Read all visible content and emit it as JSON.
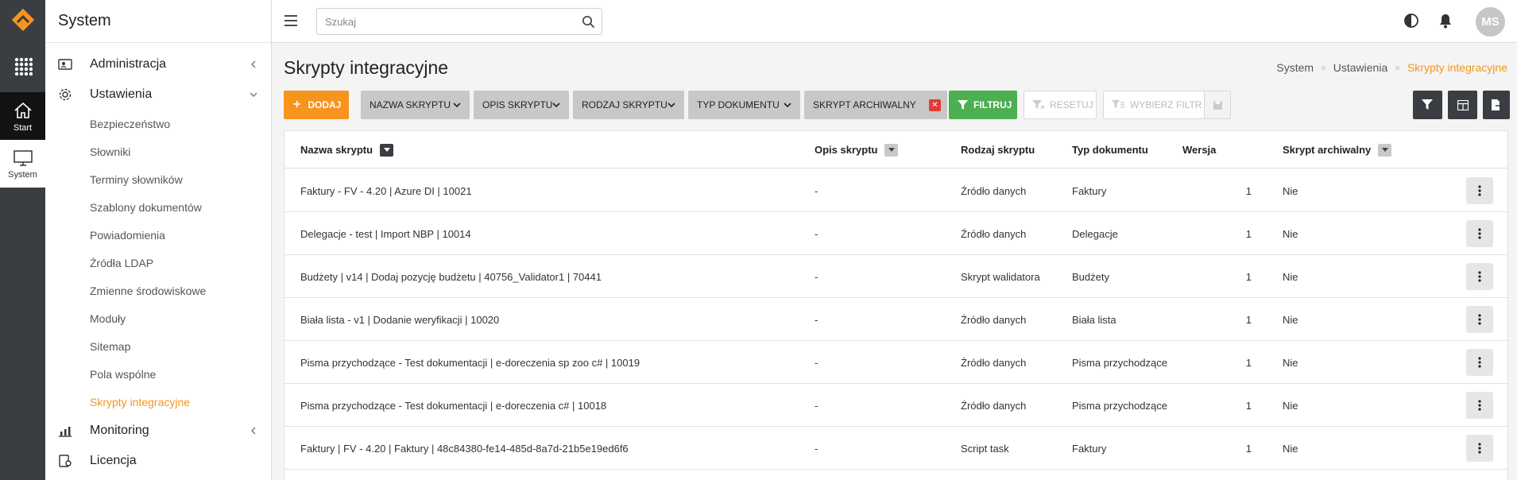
{
  "rail": {
    "items": [
      {
        "label": "Start"
      },
      {
        "label": "System"
      }
    ]
  },
  "sidebar": {
    "title": "System",
    "sections": [
      {
        "label": "Administracja"
      },
      {
        "label": "Ustawienia"
      },
      {
        "label": "Monitoring"
      },
      {
        "label": "Licencja"
      }
    ],
    "sub_items": [
      {
        "label": "Bezpieczeństwo"
      },
      {
        "label": "Słowniki"
      },
      {
        "label": "Terminy słowników"
      },
      {
        "label": "Szablony dokumentów"
      },
      {
        "label": "Powiadomienia"
      },
      {
        "label": "Źródła LDAP"
      },
      {
        "label": "Zmienne środowiskowe"
      },
      {
        "label": "Moduły"
      },
      {
        "label": "Sitemap"
      },
      {
        "label": "Pola wspólne"
      },
      {
        "label": "Skrypty integracyjne"
      }
    ]
  },
  "topbar": {
    "search_placeholder": "Szukaj",
    "avatar_initials": "MS"
  },
  "page": {
    "title": "Skrypty integracyjne",
    "breadcrumb": [
      "System",
      "Ustawienia",
      "Skrypty integracyjne"
    ]
  },
  "toolbar": {
    "add": "Dodaj",
    "filters": [
      "Nazwa skryptu",
      "Opis skryptu",
      "Rodzaj skryptu",
      "Typ dokumentu"
    ],
    "archived_filter": "Skrypt archiwalny",
    "filter_btn": "Filtruj",
    "reset_btn": "Resetuj",
    "choose_filter_btn": "Wybierz filtr"
  },
  "table": {
    "columns": [
      "Nazwa skryptu",
      "Opis skryptu",
      "Rodzaj skryptu",
      "Typ dokumentu",
      "Wersja",
      "Skrypt archiwalny"
    ],
    "rows": [
      {
        "name": "Faktury - FV - 4.20 | Azure DI | 10021",
        "desc": "-",
        "kind": "Źródło danych",
        "doc": "Faktury",
        "ver": "1",
        "arch": "Nie"
      },
      {
        "name": "Delegacje - test | Import NBP | 10014",
        "desc": "-",
        "kind": "Źródło danych",
        "doc": "Delegacje",
        "ver": "1",
        "arch": "Nie"
      },
      {
        "name": "Budżety | v14 | Dodaj pozycję budżetu | 40756_Validator1 | 70441",
        "desc": "-",
        "kind": "Skrypt walidatora",
        "doc": "Budżety",
        "ver": "1",
        "arch": "Nie"
      },
      {
        "name": "Biała lista - v1 | Dodanie weryfikacji | 10020",
        "desc": "-",
        "kind": "Źródło danych",
        "doc": "Biała lista",
        "ver": "1",
        "arch": "Nie"
      },
      {
        "name": "Pisma przychodzące - Test dokumentacji | e-doreczenia sp zoo c# | 10019",
        "desc": "-",
        "kind": "Źródło danych",
        "doc": "Pisma przychodzące",
        "ver": "1",
        "arch": "Nie"
      },
      {
        "name": "Pisma przychodzące - Test dokumentacji | e-doreczenia c# | 10018",
        "desc": "-",
        "kind": "Źródło danych",
        "doc": "Pisma przychodzące",
        "ver": "1",
        "arch": "Nie"
      },
      {
        "name": "Faktury | FV - 4.20 | Faktury | 48c84380-fe14-485d-8a7d-21b5e19ed6f6",
        "desc": "-",
        "kind": "Script task",
        "doc": "Faktury",
        "ver": "1",
        "arch": "Nie"
      }
    ]
  },
  "colors": {
    "accent": "#f7941d",
    "filter_green": "#4caf50",
    "rail_bg": "#3a3d41",
    "danger": "#e53935"
  }
}
